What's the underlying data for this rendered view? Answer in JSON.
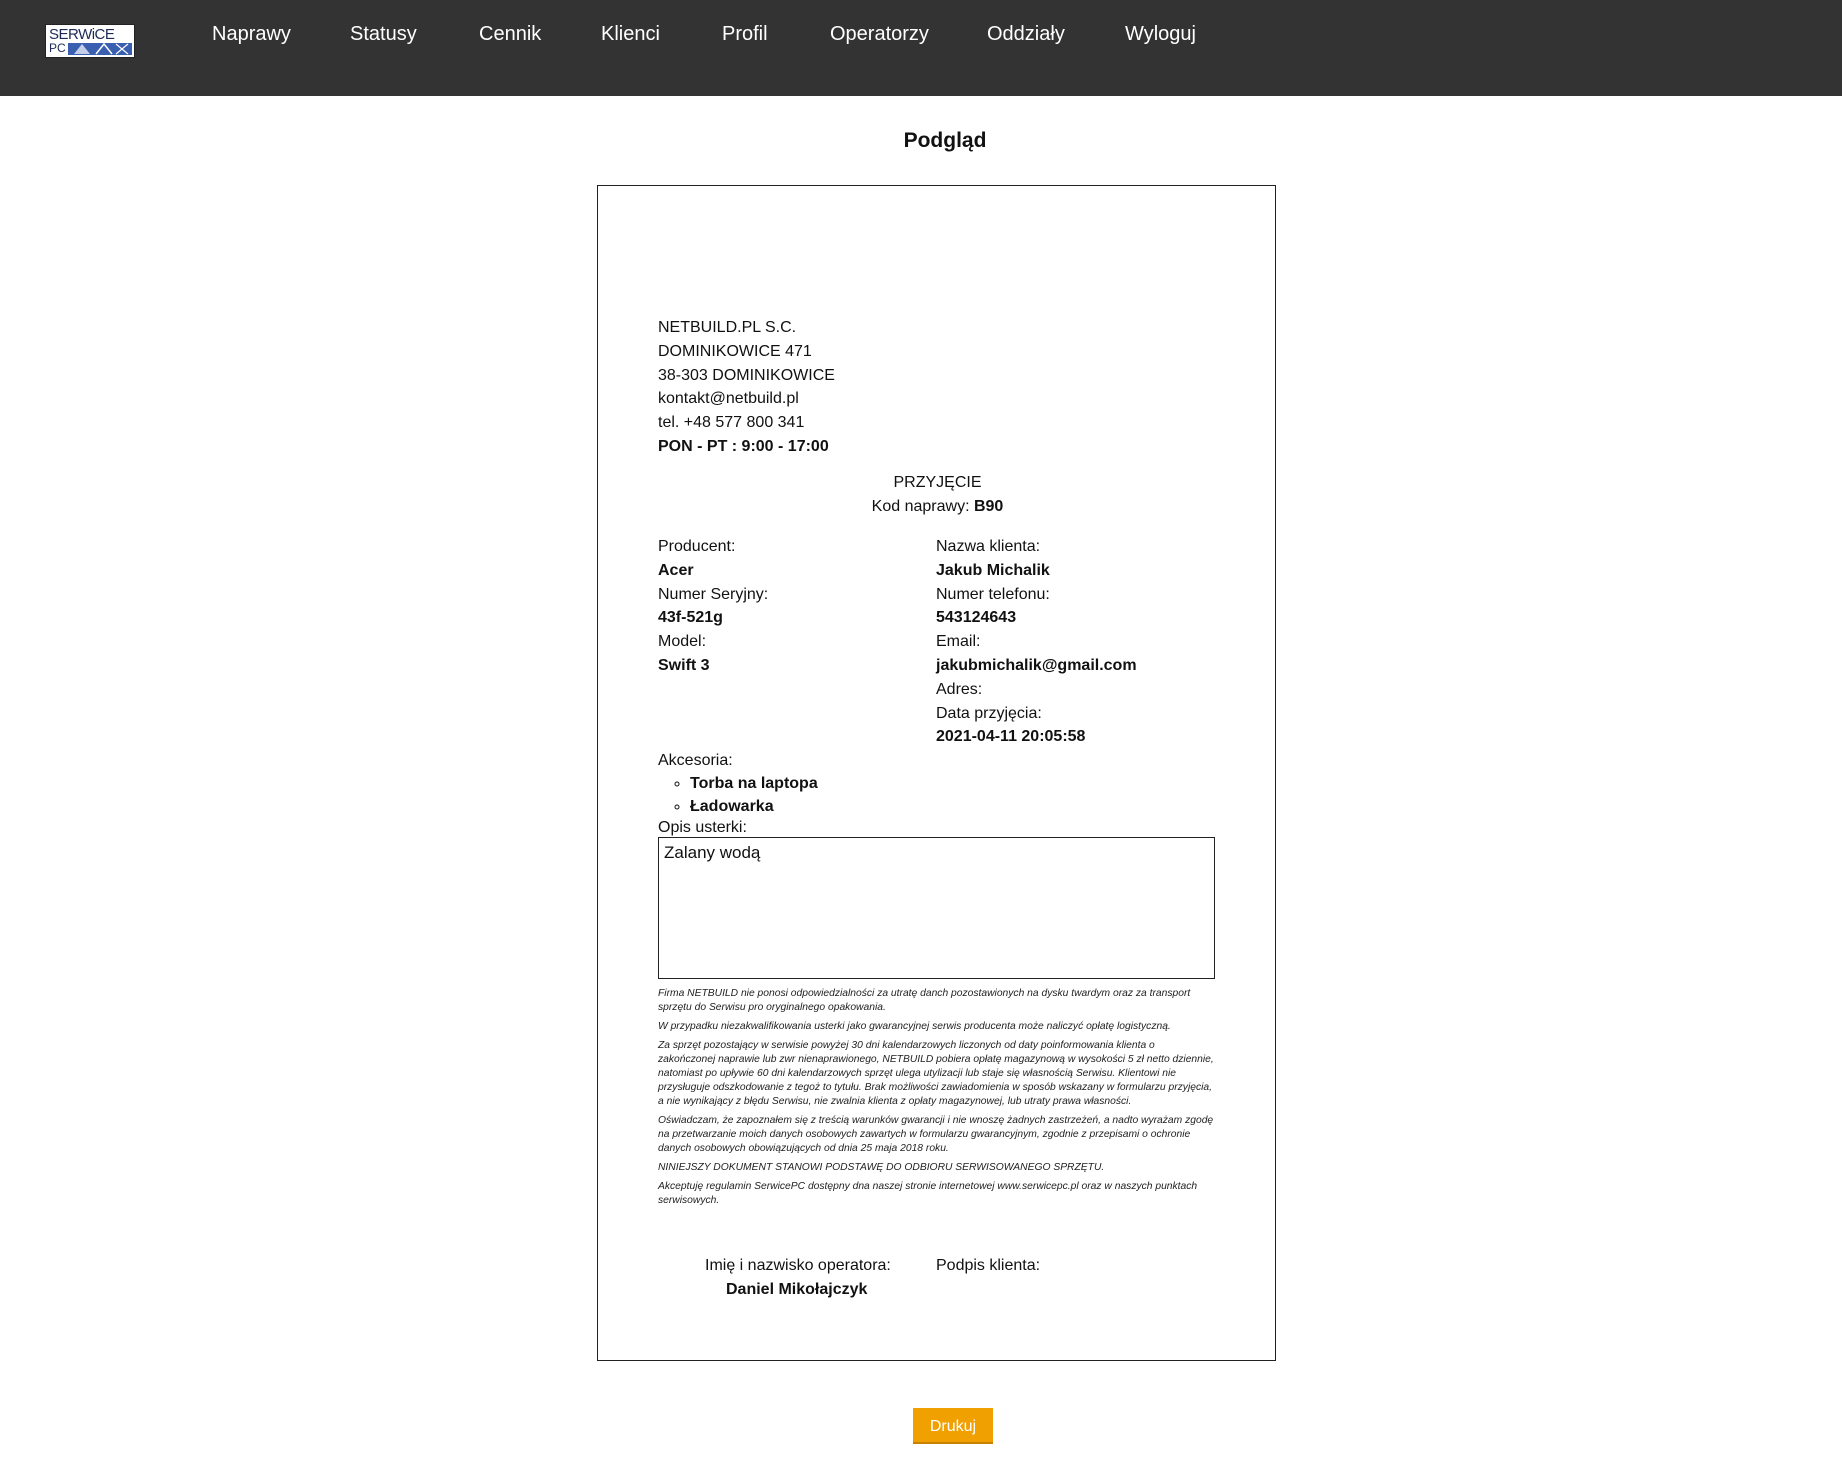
{
  "header": {
    "logo": {
      "word": "SERWiCE",
      "sub": "PC"
    },
    "nav": [
      {
        "label": "Naprawy"
      },
      {
        "label": "Statusy"
      },
      {
        "label": "Cennik"
      },
      {
        "label": "Klienci"
      },
      {
        "label": "Profil"
      },
      {
        "label": "Operatorzy"
      },
      {
        "label": "Oddziały"
      },
      {
        "label": "Wyloguj"
      }
    ]
  },
  "page": {
    "title": "Podgląd"
  },
  "company": {
    "name": "NETBUILD.PL S.C.",
    "street": "DOMINIKOWICE 471",
    "city": "38-303 DOMINIKOWICE",
    "email": "kontakt@netbuild.pl",
    "phone": "tel. +48 577 800 341",
    "hours": "PON - PT : 9:00 - 17:00"
  },
  "receipt": {
    "type": "PRZYJĘCIE",
    "code_label": "Kod naprawy:",
    "code": "B90"
  },
  "device": {
    "producer_label": "Producent:",
    "producer": "Acer",
    "serial_label": "Numer Seryjny:",
    "serial": "43f-521g",
    "model_label": "Model:",
    "model": "Swift 3"
  },
  "client": {
    "name_label": "Nazwa klienta:",
    "name": "Jakub Michalik",
    "phone_label": "Numer telefonu:",
    "phone": "543124643",
    "email_label": "Email:",
    "email": "jakubmichalik@gmail.com",
    "address_label": "Adres:",
    "date_label": "Data przyjęcia:",
    "date": "2021-04-11 20:05:58"
  },
  "accessories": {
    "label": "Akcesoria:",
    "items": [
      "Torba na laptopa",
      "Ładowarka"
    ]
  },
  "fault": {
    "label": "Opis usterki:",
    "text": "Zalany wodą"
  },
  "terms": [
    "Firma NETBUILD nie ponosi odpowiedzialności za utratę danch pozostawionych na dysku twardym oraz za transport sprzętu do Serwisu pro oryginalnego opakowania.",
    "W przypadku niezakwalifikowania usterki jako gwarancyjnej serwis producenta może naliczyć opłatę logistyczną.",
    "Za sprzęt pozostający w serwisie powyżej 30 dni kalendarzowych liczonych od daty poinformowania klienta o zakończonej naprawie lub zwr nienaprawionego, NETBUILD pobiera opłatę magazynową w wysokości 5 zł netto dziennie, natomiast po upływie 60 dni kalendarzowych sprzęt ulega utylizacji lub staje się własnością Serwisu. Klientowi nie przysługuje odszkodowanie z tegoż to tytułu. Brak możliwości zawiadomienia w sposób wskazany w formularzu przyjęcia, a nie wynikający z błędu Serwisu, nie zwalnia klienta z opłaty magazynowej, lub utraty prawa własności.",
    "Oświadczam, że zapoznałem się z treścią warunków gwarancji i nie wnoszę żadnych zastrzeżeń, a nadto wyrażam zgodę na przetwarzanie moich danych osobowych zawartych w formularzu gwarancyjnym, zgodnie z przepisami o ochronie danych osobowych obowiązujących od dnia 25 maja 2018 roku.",
    "NINIEJSZY DOKUMENT STANOWI PODSTAWĘ DO ODBIORU SERWISOWANEGO SPRZĘTU.",
    "Akceptuję regulamin SerwicePC dostępny dna naszej stronie internetowej www.serwicepc.pl oraz w naszych punktach serwisowych."
  ],
  "signatures": {
    "operator_label": "Imię i nazwisko operatora:",
    "operator_name": "Daniel Mikołajczyk",
    "client_label": "Podpis klienta:"
  },
  "actions": {
    "print_label": "Drukuj"
  },
  "colors": {
    "topbar": "#333333",
    "print_button": "#f0a000"
  }
}
